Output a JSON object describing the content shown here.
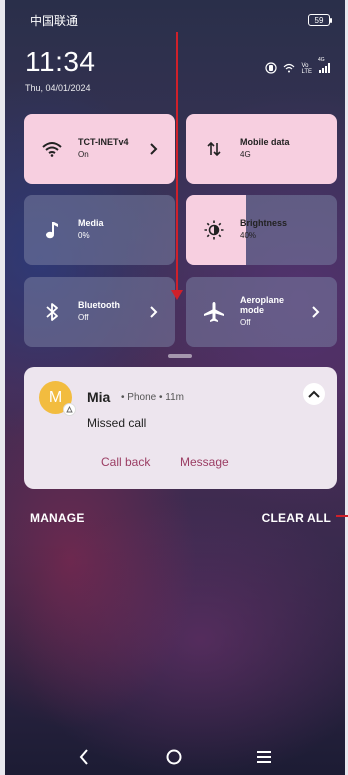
{
  "status_bar": {
    "carrier": "中国联通",
    "battery": "59"
  },
  "lock": {
    "time": "11:34",
    "date": "Thu, 04/01/2024"
  },
  "sys_icons": {
    "network_label_top": "Vo",
    "network_label_bottom": "LTE",
    "network_small": "4G"
  },
  "tiles": {
    "wifi": {
      "title": "TCT-INETv4",
      "status": "On"
    },
    "mobile_data": {
      "title": "Mobile data",
      "status": "4G"
    },
    "media": {
      "title": "Media",
      "status": "0%"
    },
    "brightness": {
      "title": "Brightness",
      "status": "40%",
      "level": 0.4
    },
    "bluetooth": {
      "title": "Bluetooth",
      "status": "Off"
    },
    "aeroplane": {
      "title_line1": "Aeroplane",
      "title_line2": "mode",
      "status": "Off"
    }
  },
  "notification": {
    "avatar_letter": "M",
    "sender": "Mia",
    "meta": "• Phone • 11m",
    "body": "Missed call",
    "actions": [
      "Call back",
      "Message"
    ]
  },
  "controls": {
    "manage": "MANAGE",
    "clear_all": "CLEAR ALL"
  },
  "colors": {
    "active_tile": "#f7cfe0",
    "accent_text": "#9b3d63",
    "annotation_arrow": "#d0202a"
  }
}
